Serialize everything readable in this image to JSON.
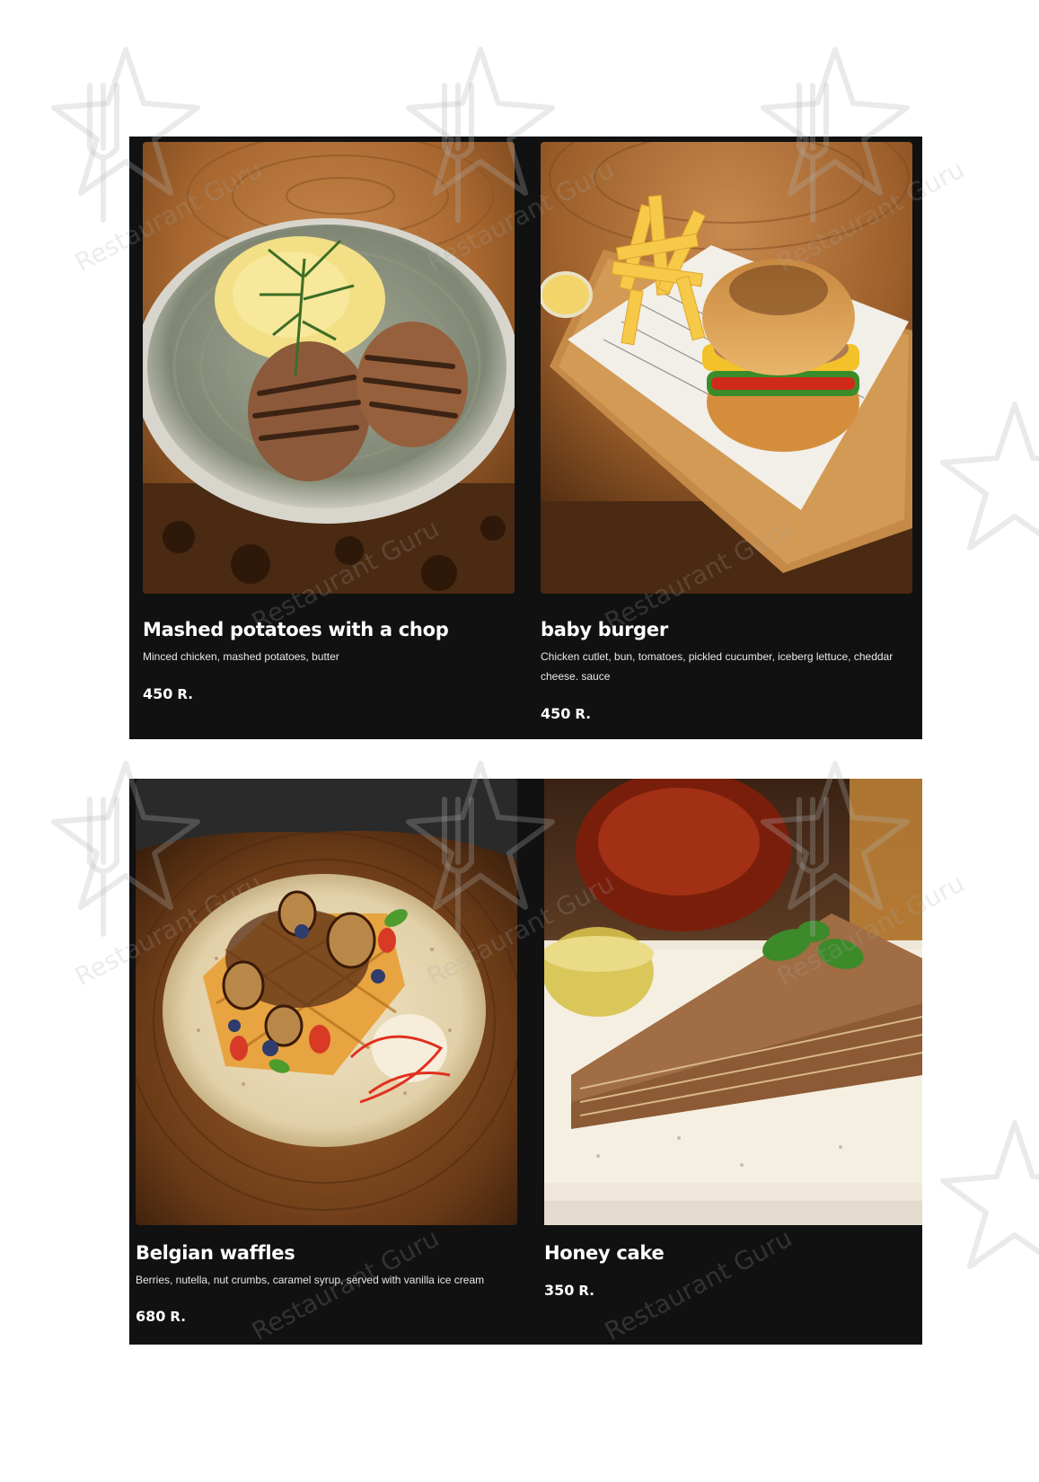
{
  "menu": {
    "items": [
      {
        "title": "Mashed potatoes with a chop",
        "description": "Minced chicken, mashed potatoes, butter",
        "price": "450",
        "currency": "R.",
        "photo_icon": "chicken-cutlets-with-mashed-potatoes-photo"
      },
      {
        "title": "baby burger",
        "description": "Chicken cutlet, bun, tomatoes, pickled cucumber, iceberg lettuce, cheddar cheese. sauce",
        "price": "450",
        "currency": "R.",
        "photo_icon": "burger-with-fries-photo"
      },
      {
        "title": "Belgian waffles",
        "description": "Berries, nutella, nut crumbs, caramel syrup, served with vanilla ice cream",
        "price": "680",
        "currency": "R.",
        "photo_icon": "belgian-waffles-photo"
      },
      {
        "title": "Honey cake",
        "description": "",
        "price": "350",
        "currency": "R.",
        "photo_icon": "honey-cake-photo"
      }
    ]
  },
  "watermark": {
    "text": "Restaurant Guru",
    "icon": "fork-star-logo"
  },
  "colors": {
    "panel_background": "#111111",
    "page_background": "#ffffff",
    "text": "#ffffff"
  }
}
